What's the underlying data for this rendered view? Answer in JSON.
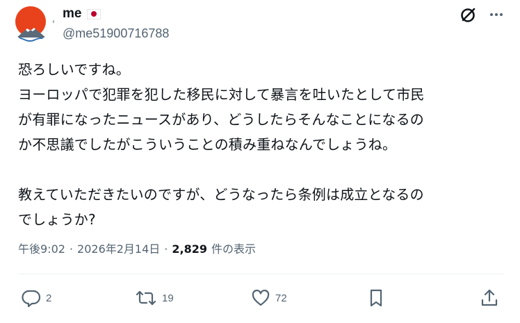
{
  "author": {
    "display_name": "me",
    "flag": "japan-flag",
    "handle": "@me51900716788"
  },
  "tweet": {
    "text": "恐ろしいですね。\nヨーロッパで犯罪を犯した移民に対して暴言を吐いたとして市民\nが有罪になったニュースがあり、どうしたらそんなことになるの\nか不思議でしたがこういうことの積み重ねなんでしょうね。\n\n教えていただきたいのですが、どうなったら条例は成立となるの\nでしょうか?",
    "time": "午後9:02",
    "separator": "·",
    "date": "2026年2月14日",
    "views_count": "2,829",
    "views_label": "件の表示"
  },
  "actions": {
    "reply_count": "2",
    "repost_count": "19",
    "like_count": "72"
  },
  "colors": {
    "text": "#0f1419",
    "secondary": "#536471",
    "flag_red": "#bc002d",
    "avatar_sun": "#e8421c"
  }
}
